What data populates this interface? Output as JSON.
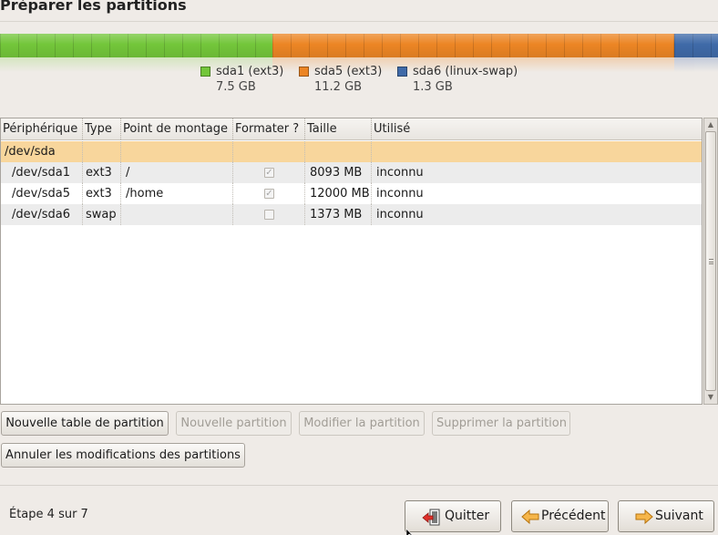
{
  "header": {
    "title": "Préparer les partitions"
  },
  "partition_bar": {
    "segments": [
      {
        "name": "sda1 (ext3)",
        "size": "7.5 GB",
        "size_gb": 7.5,
        "color": "#73c63a"
      },
      {
        "name": "sda5 (ext3)",
        "size": "11.2 GB",
        "size_gb": 11.2,
        "color": "#ec8524"
      },
      {
        "name": "sda6 (linux-swap)",
        "size": "1.3 GB",
        "size_gb": 1.3,
        "color": "#3f6aa8"
      }
    ]
  },
  "table": {
    "headers": {
      "device": "Périphérique",
      "type": "Type",
      "mount": "Point de montage",
      "format": "Formater ?",
      "size": "Taille",
      "used": "Utilisé"
    },
    "disk": {
      "device": "/dev/sda"
    },
    "rows": [
      {
        "device": "/dev/sda1",
        "type": "ext3",
        "mount": "/",
        "format": true,
        "size": "8093 MB",
        "used": "inconnu"
      },
      {
        "device": "/dev/sda5",
        "type": "ext3",
        "mount": "/home",
        "format": true,
        "size": "12000 MB",
        "used": "inconnu"
      },
      {
        "device": "/dev/sda6",
        "type": "swap",
        "mount": "",
        "format": false,
        "size": "1373 MB",
        "used": "inconnu"
      }
    ]
  },
  "actions": {
    "new_table": "Nouvelle table de partition",
    "new_partition": "Nouvelle partition",
    "edit_partition": "Modifier la partition",
    "delete_partition": "Supprimer la partition",
    "undo_changes": "Annuler les modifications des partitions"
  },
  "footer": {
    "step": "Étape 4 sur 7",
    "quit_label": "Quitter",
    "back_label": "Précédent",
    "next_label": "Suivant"
  },
  "icons": {
    "quit": "quit-door-icon",
    "back": "arrow-left-icon",
    "next": "arrow-right-icon"
  }
}
